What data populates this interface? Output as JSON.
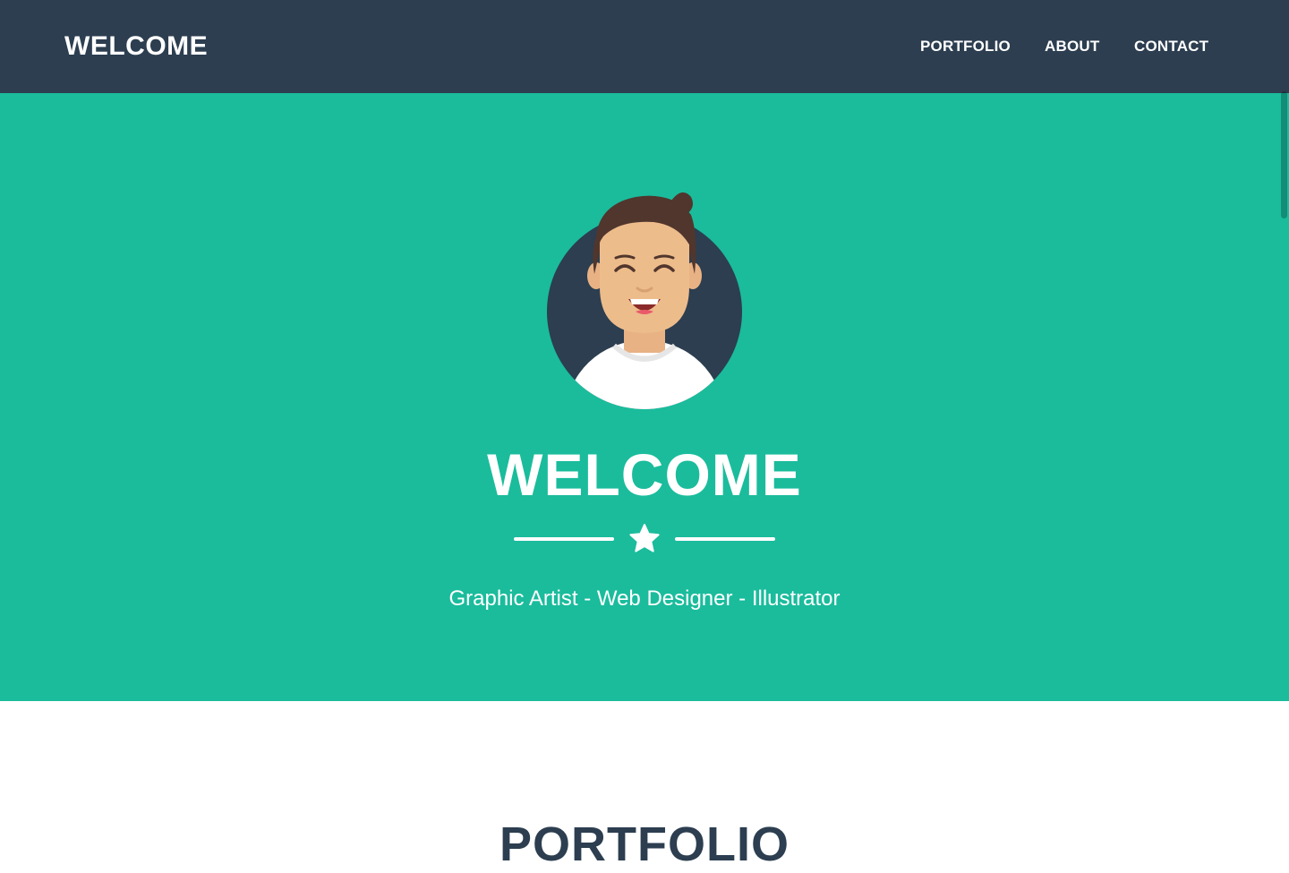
{
  "navbar": {
    "brand": "WELCOME",
    "links": [
      "PORTFOLIO",
      "ABOUT",
      "CONTACT"
    ]
  },
  "masthead": {
    "title": "WELCOME",
    "subtitle": "Graphic Artist - Web Designer - Illustrator",
    "divider_icon": "star-icon",
    "avatar_icon": "avatar-icon"
  },
  "portfolio": {
    "heading": "PORTFOLIO"
  },
  "colors": {
    "navbar_bg": "#2c3e50",
    "masthead_bg": "#1abc9c",
    "text_light": "#ffffff",
    "heading_dark": "#2c3e50"
  }
}
